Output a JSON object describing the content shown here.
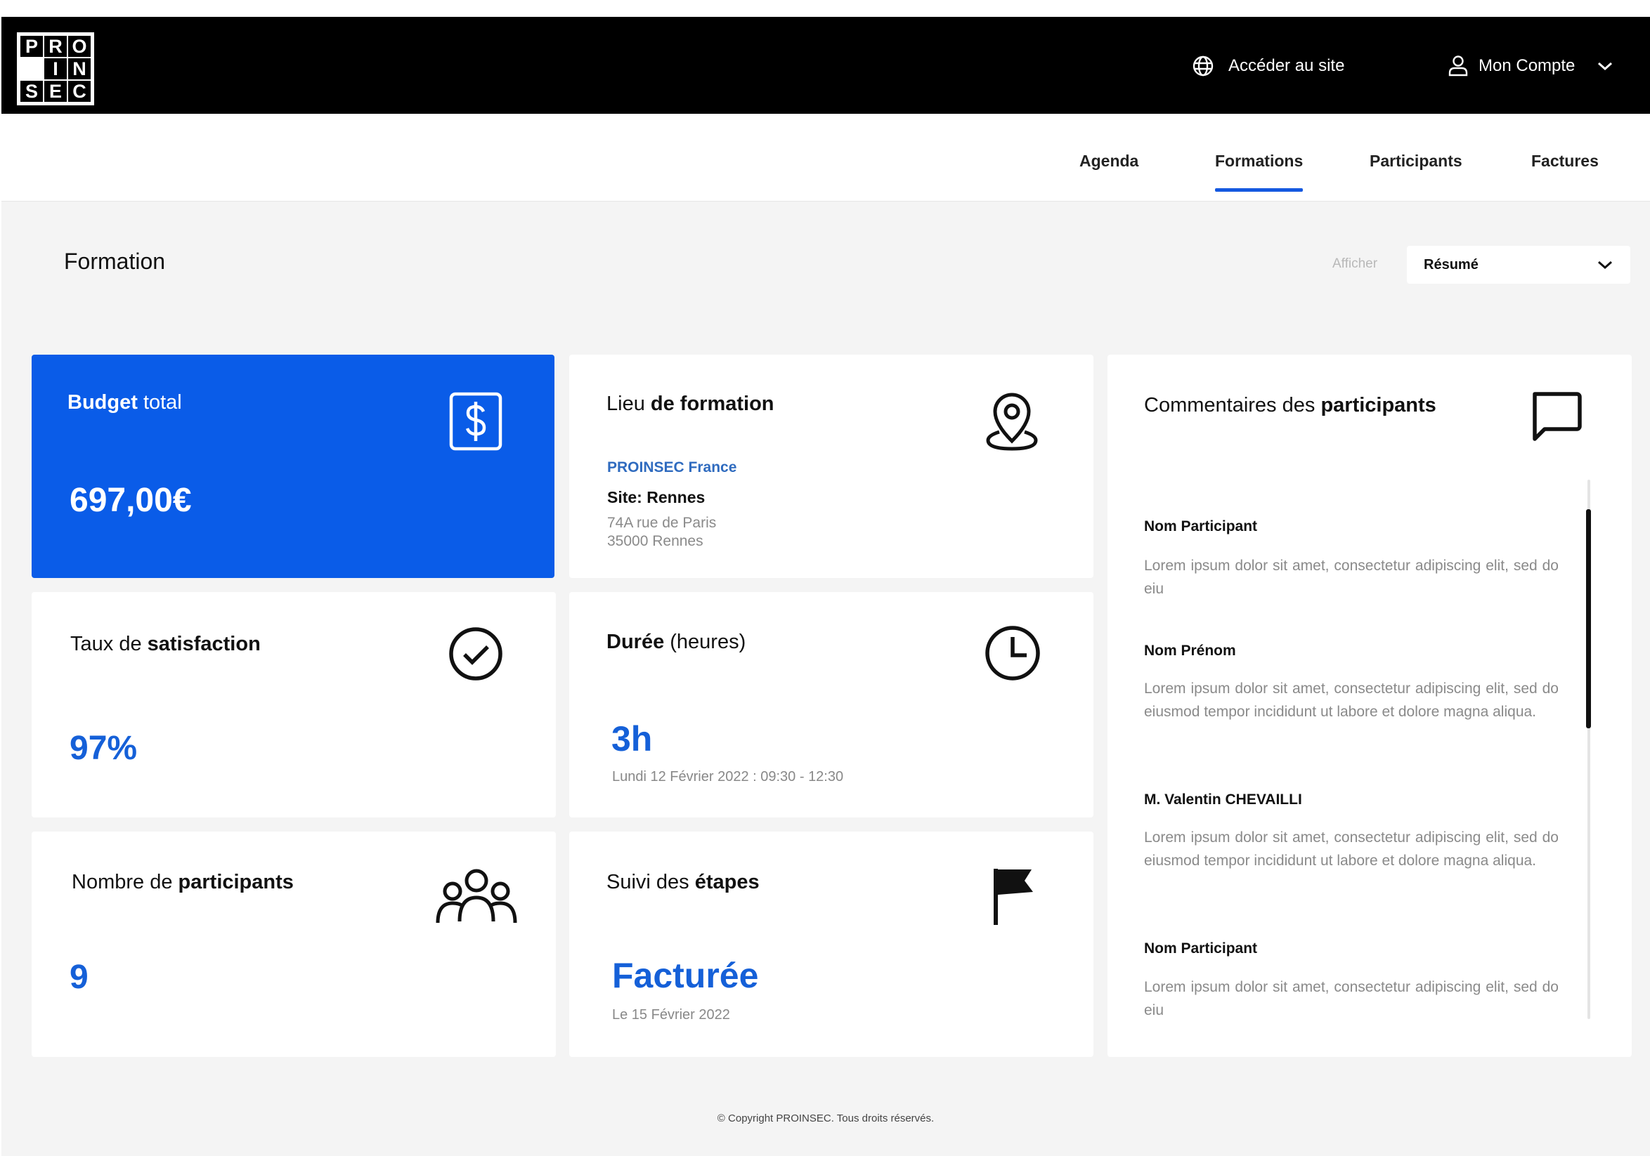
{
  "header": {
    "logo_letters": [
      "P",
      "R",
      "O",
      "",
      "I",
      "N",
      "S",
      "E",
      "C"
    ],
    "site_link": "Accéder au site",
    "account_label": "Mon Compte",
    "icons": {
      "site": "globe-icon",
      "account": "user-icon",
      "account_menu": "chevron-down-icon"
    }
  },
  "nav": {
    "tabs": [
      {
        "label": "Agenda",
        "active": false
      },
      {
        "label": "Formations",
        "active": true
      },
      {
        "label": "Participants",
        "active": false
      },
      {
        "label": "Factures",
        "active": false
      }
    ]
  },
  "page": {
    "title": "Formation",
    "display_label": "Afficher",
    "display_value": "Résumé"
  },
  "cards": {
    "budget": {
      "title_bold": "Budget",
      "title_rest": "total",
      "value": "697,00€",
      "icon": "dollar-icon"
    },
    "location": {
      "title_regular": "Lieu",
      "title_bold": "de formation",
      "company": "PROINSEC France",
      "site": "Site: Rennes",
      "address_line1": "74A rue de Paris",
      "address_line2": "35000 Rennes",
      "icon": "location-pin-icon"
    },
    "satisfaction": {
      "title_regular": "Taux de",
      "title_bold": "satisfaction",
      "value": "97%",
      "icon": "check-circle-icon"
    },
    "duration": {
      "title_bold": "Durée",
      "title_regular": "(heures)",
      "value": "3h",
      "detail": "Lundi 12 Février 2022 : 09:30 - 12:30",
      "icon": "clock-icon"
    },
    "participants": {
      "title_regular": "Nombre de",
      "title_bold": "participants",
      "value": "9",
      "icon": "group-icon"
    },
    "steps": {
      "title_regular": "Suivi des",
      "title_bold": "étapes",
      "value": "Facturée",
      "detail": "Le 15 Février 2022",
      "icon": "flag-icon"
    }
  },
  "comments": {
    "title_regular": "Commentaires des",
    "title_bold": "participants",
    "icon": "chat-bubble-icon",
    "items": [
      {
        "name": "Nom Participant",
        "text": "Lorem ipsum dolor sit amet, consectetur adipiscing elit, sed do eiu"
      },
      {
        "name": "Nom Prénom",
        "text": "Lorem ipsum dolor sit amet, consectetur adipiscing elit, sed do eiusmod tempor incididunt ut labore et dolore magna aliqua."
      },
      {
        "name": "M. Valentin CHEVAILLI",
        "text": "Lorem ipsum dolor sit amet, consectetur adipiscing elit, sed do eiusmod tempor incididunt ut labore et dolore magna aliqua."
      },
      {
        "name": "Nom Participant",
        "text": "Lorem ipsum dolor sit amet, consectetur adipiscing elit, sed do eiu"
      }
    ]
  },
  "footer": {
    "copyright": "© Copyright PROINSEC. Tous droits réservés."
  },
  "colors": {
    "accent": "#0a5ce8",
    "value_blue": "#1560d8",
    "header_bg": "#000000",
    "page_bg": "#f4f4f4"
  }
}
